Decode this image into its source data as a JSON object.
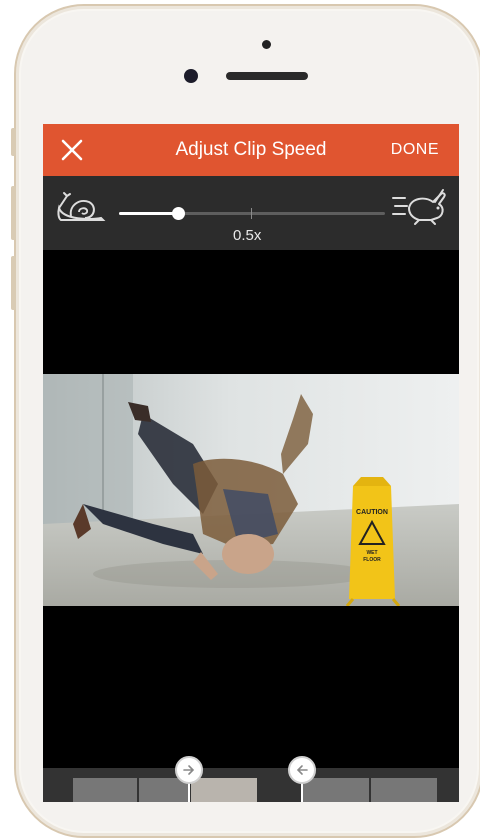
{
  "header": {
    "title": "Adjust Clip Speed",
    "done_label": "DONE",
    "close_icon": "close-icon"
  },
  "speed": {
    "label": "0.5x",
    "slider_fraction": 0.22,
    "slow_icon": "snail-icon",
    "fast_icon": "rabbit-icon"
  },
  "video": {
    "sign_text_1": "CAUTION",
    "sign_text_2": "WET",
    "sign_text_3": "FLOOR"
  },
  "colors": {
    "accent": "#e05530",
    "bar": "#2c2c2c"
  }
}
